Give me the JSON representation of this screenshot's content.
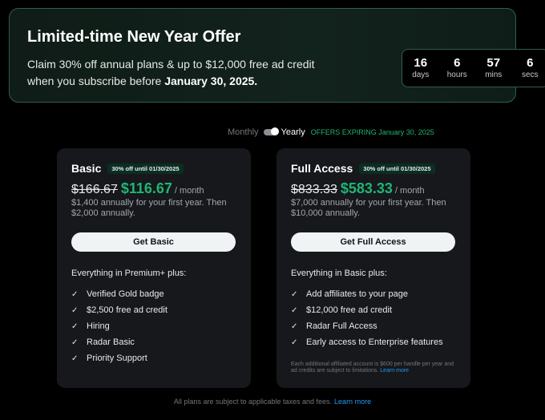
{
  "banner": {
    "title": "Limited-time New Year Offer",
    "text": "Claim 30% off annual plans & up to $12,000 free ad credit when you subscribe before ",
    "deadline": "January 30, 2025.",
    "countdown": [
      {
        "value": "16",
        "label": "days"
      },
      {
        "value": "6",
        "label": "hours"
      },
      {
        "value": "57",
        "label": "mins"
      },
      {
        "value": "6",
        "label": "secs"
      }
    ]
  },
  "billing": {
    "monthly_label": "Monthly",
    "yearly_label": "Yearly",
    "offer_text": "OFFERS EXPIRING January 30, 2025",
    "selected": "Yearly"
  },
  "plans": [
    {
      "name": "Basic",
      "badge": "30% off until 01/30/2025",
      "old_price": "$166.67",
      "new_price": "$116.67",
      "per": "/ month",
      "annual_note": "$1,400 annually for your first year. Then $2,000 annually.",
      "cta": "Get Basic",
      "includes": "Everything in Premium+ plus:",
      "features": [
        "Verified Gold badge",
        "$2,500 free ad credit",
        "Hiring",
        "Radar Basic",
        "Priority Support"
      ]
    },
    {
      "name": "Full Access",
      "badge": "30% off until 01/30/2025",
      "old_price": "$833.33",
      "new_price": "$583.33",
      "per": "/ month",
      "annual_note": "$7,000 annually for your first year. Then $10,000 annually.",
      "cta": "Get Full Access",
      "includes": "Everything in Basic plus:",
      "features": [
        "Add affiliates to your page",
        "$12,000 free ad credit",
        "Radar Full Access",
        "Early access to Enterprise features"
      ],
      "footnote": "Each additional affiliated account is $600 per handle per year and ad credits are subject to limitations.",
      "footnote_link": "Learn more"
    }
  ],
  "legal": {
    "text": "All plans are subject to applicable taxes and fees.",
    "link": "Learn more"
  },
  "colors": {
    "accent_green": "#1fb574",
    "banner_border": "#2f5f48",
    "card_bg": "#16181c",
    "link_blue": "#1d9bf0"
  }
}
